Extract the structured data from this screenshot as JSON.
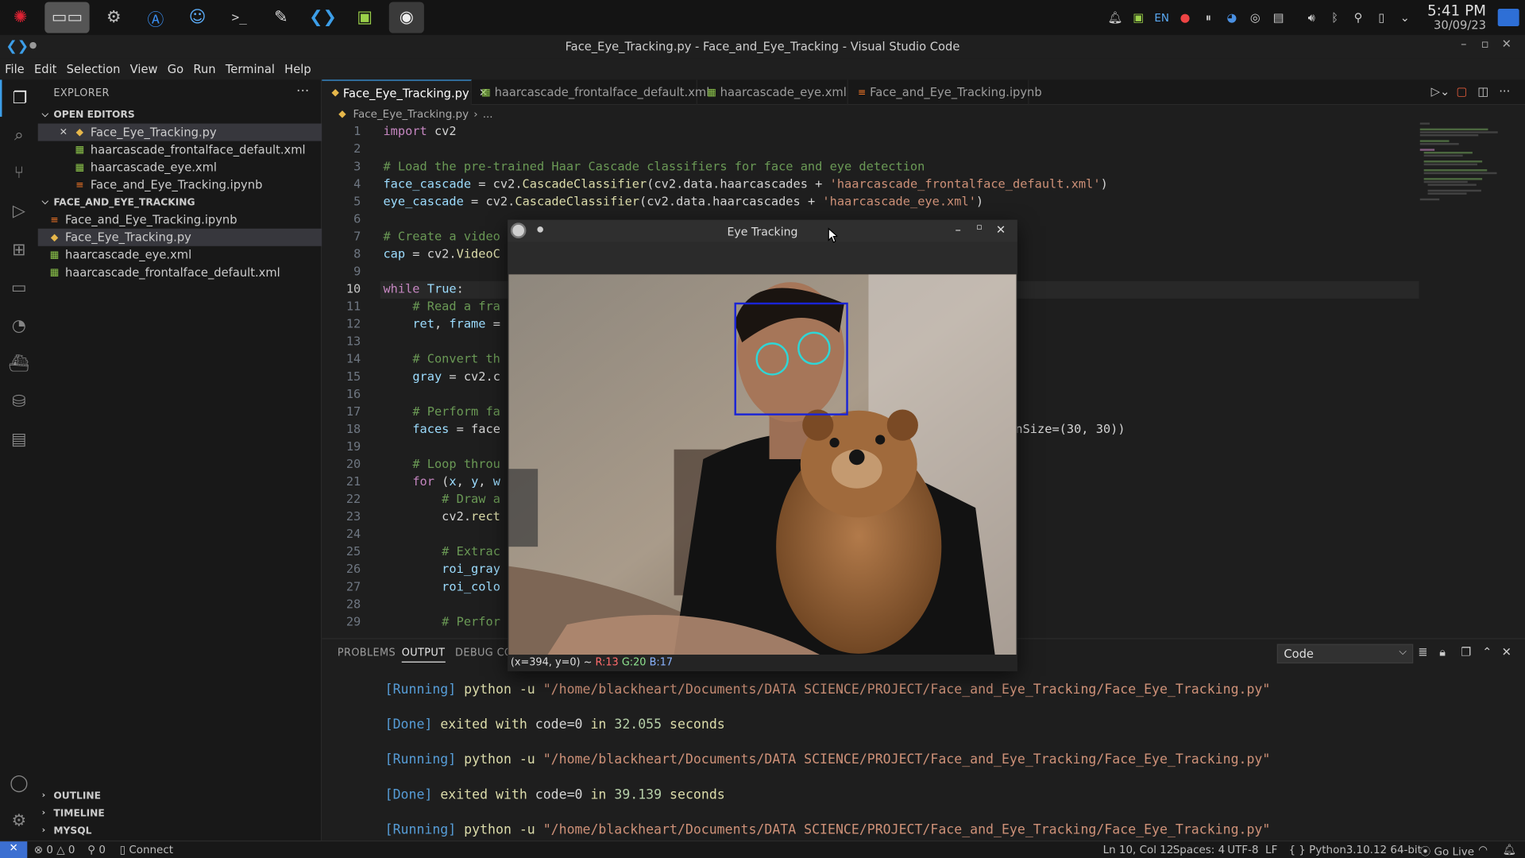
{
  "taskbar": {
    "apps": [
      {
        "icon": "spider-icon"
      },
      {
        "icon": "window-switcher-icon"
      },
      {
        "icon": "system-settings-icon"
      },
      {
        "icon": "app-store-icon"
      },
      {
        "icon": "finder-icon"
      },
      {
        "icon": "terminal-icon"
      },
      {
        "icon": "notes-icon"
      },
      {
        "icon": "vscode-icon"
      },
      {
        "icon": "android-icon"
      },
      {
        "icon": "eye-tracking-app-icon"
      }
    ],
    "tray": {
      "lang": "EN",
      "time": "5:41 PM",
      "date": "30/09/23"
    }
  },
  "window": {
    "title": "Face_Eye_Tracking.py - Face_and_Eye_Tracking - Visual Studio Code"
  },
  "menu": [
    "File",
    "Edit",
    "Selection",
    "View",
    "Go",
    "Run",
    "Terminal",
    "Help"
  ],
  "explorer": {
    "title": "EXPLORER",
    "open_editors_label": "OPEN EDITORS",
    "open_editors": [
      {
        "name": "Face_Eye_Tracking.py",
        "type": "py"
      },
      {
        "name": "haarcascade_frontalface_default.xml",
        "type": "xml"
      },
      {
        "name": "haarcascade_eye.xml",
        "type": "xml"
      },
      {
        "name": "Face_and_Eye_Tracking.ipynb",
        "type": "nb"
      }
    ],
    "folder_label": "FACE_AND_EYE_TRACKING",
    "files": [
      {
        "name": "Face_and_Eye_Tracking.ipynb",
        "type": "nb"
      },
      {
        "name": "Face_Eye_Tracking.py",
        "type": "py"
      },
      {
        "name": "haarcascade_eye.xml",
        "type": "xml"
      },
      {
        "name": "haarcascade_frontalface_default.xml",
        "type": "xml"
      }
    ],
    "outline": "OUTLINE",
    "timeline": "TIMELINE",
    "mysql": "MYSQL"
  },
  "tabs": [
    {
      "label": "Face_Eye_Tracking.py",
      "type": "py"
    },
    {
      "label": "haarcascade_frontalface_default.xml",
      "type": "xml"
    },
    {
      "label": "haarcascade_eye.xml",
      "type": "xml"
    },
    {
      "label": "Face_and_Eye_Tracking.ipynb",
      "type": "nb"
    }
  ],
  "breadcrumb": {
    "file": "Face_Eye_Tracking.py",
    "rest": "..."
  },
  "editor": {
    "current_line": 10,
    "lines": [
      {
        "n": "1",
        "html": "<span class='kw'>import</span> cv2"
      },
      {
        "n": "2",
        "html": ""
      },
      {
        "n": "3",
        "html": "<span class='cm'># Load the pre-trained Haar Cascade classifiers for face and eye detection</span>"
      },
      {
        "n": "4",
        "html": "<span class='vr'>face_cascade</span> = cv2.<span class='fn'>CascadeClassifier</span>(cv2.data.haarcascades + <span class='st'>'haarcascade_frontalface_default.xml'</span>)"
      },
      {
        "n": "5",
        "html": "<span class='vr'>eye_cascade</span> = cv2.<span class='fn'>CascadeClassifier</span>(cv2.data.haarcascades + <span class='st'>'haarcascade_eye.xml'</span>)"
      },
      {
        "n": "6",
        "html": ""
      },
      {
        "n": "7",
        "html": "<span class='cm'># Create a video</span>"
      },
      {
        "n": "8",
        "html": "<span class='vr'>cap</span> = cv2.<span class='fn'>VideoC</span>"
      },
      {
        "n": "9",
        "html": ""
      },
      {
        "n": "10",
        "html": "<span class='kw'>while</span> <span class='vr'>True</span>:"
      },
      {
        "n": "11",
        "html": "    <span class='cm'># Read a fra</span>"
      },
      {
        "n": "12",
        "html": "    <span class='vr'>ret</span>, <span class='vr'>frame</span> ="
      },
      {
        "n": "13",
        "html": ""
      },
      {
        "n": "14",
        "html": "    <span class='cm'># Convert th</span>"
      },
      {
        "n": "15",
        "html": "    <span class='vr'>gray</span> = cv2.c"
      },
      {
        "n": "16",
        "html": ""
      },
      {
        "n": "17",
        "html": "    <span class='cm'># Perform fa</span>"
      },
      {
        "n": "18",
        "html": "    <span class='vr'>faces</span> = face"
      },
      {
        "n": "19",
        "html": ""
      },
      {
        "n": "20",
        "html": "    <span class='cm'># Loop throu</span>"
      },
      {
        "n": "21",
        "html": "    <span class='kw'>for</span> (<span class='vr'>x</span>, <span class='vr'>y</span>, <span class='vr'>w</span>"
      },
      {
        "n": "22",
        "html": "        <span class='cm'># Draw a</span>"
      },
      {
        "n": "23",
        "html": "        cv2.<span class='fn'>rect</span>"
      },
      {
        "n": "24",
        "html": ""
      },
      {
        "n": "25",
        "html": "        <span class='cm'># Extrac</span>"
      },
      {
        "n": "26",
        "html": "        <span class='vr'>roi_gray</span>"
      },
      {
        "n": "27",
        "html": "        <span class='vr'>roi_colo</span>"
      },
      {
        "n": "28",
        "html": ""
      },
      {
        "n": "29",
        "html": "        <span class='cm'># Perfor</span>"
      }
    ],
    "line18_tail": "nSize=(30, 30))"
  },
  "panel": {
    "tabs": [
      "PROBLEMS",
      "OUTPUT",
      "DEBUG CON"
    ],
    "channel": "Code",
    "output": [
      {
        "tag": "[Running]",
        "cmd": "python -u",
        "path": "\"/home/blackheart/Documents/DATA SCIENCE/PROJECT/Face_and_Eye_Tracking/Face_Eye_Tracking.py\""
      },
      {
        "tag": "[Done]",
        "text": "exited with",
        "code": "code=0",
        "in": "in",
        "secs": "32.055",
        "unit": "seconds"
      },
      {
        "tag": "[Running]",
        "cmd": "python -u",
        "path": "\"/home/blackheart/Documents/DATA SCIENCE/PROJECT/Face_and_Eye_Tracking/Face_Eye_Tracking.py\""
      },
      {
        "tag": "[Done]",
        "text": "exited with",
        "code": "code=0",
        "in": "in",
        "secs": "39.139",
        "unit": "seconds"
      },
      {
        "tag": "[Running]",
        "cmd": "python -u",
        "path": "\"/home/blackheart/Documents/DATA SCIENCE/PROJECT/Face_and_Eye_Tracking/Face_Eye_Tracking.py\""
      }
    ]
  },
  "statusbar": {
    "errors": "0",
    "warnings": "0",
    "ports": "0",
    "connect": "Connect",
    "position": "Ln 10, Col 12",
    "spaces": "Spaces: 4",
    "encoding": "UTF-8",
    "eol": "LF",
    "language": "Python",
    "interpreter": "3.10.12 64-bit",
    "golive": "Go Live"
  },
  "eye_window": {
    "title": "Eye Tracking",
    "coords": "(x=394, y=0) ~",
    "r": "R:13",
    "g": "G:20",
    "b": "B:17"
  },
  "colors": {
    "accent": "#3c9ee8",
    "face_box": "#1a24d6",
    "eye_circle": "#2fd6d6"
  }
}
